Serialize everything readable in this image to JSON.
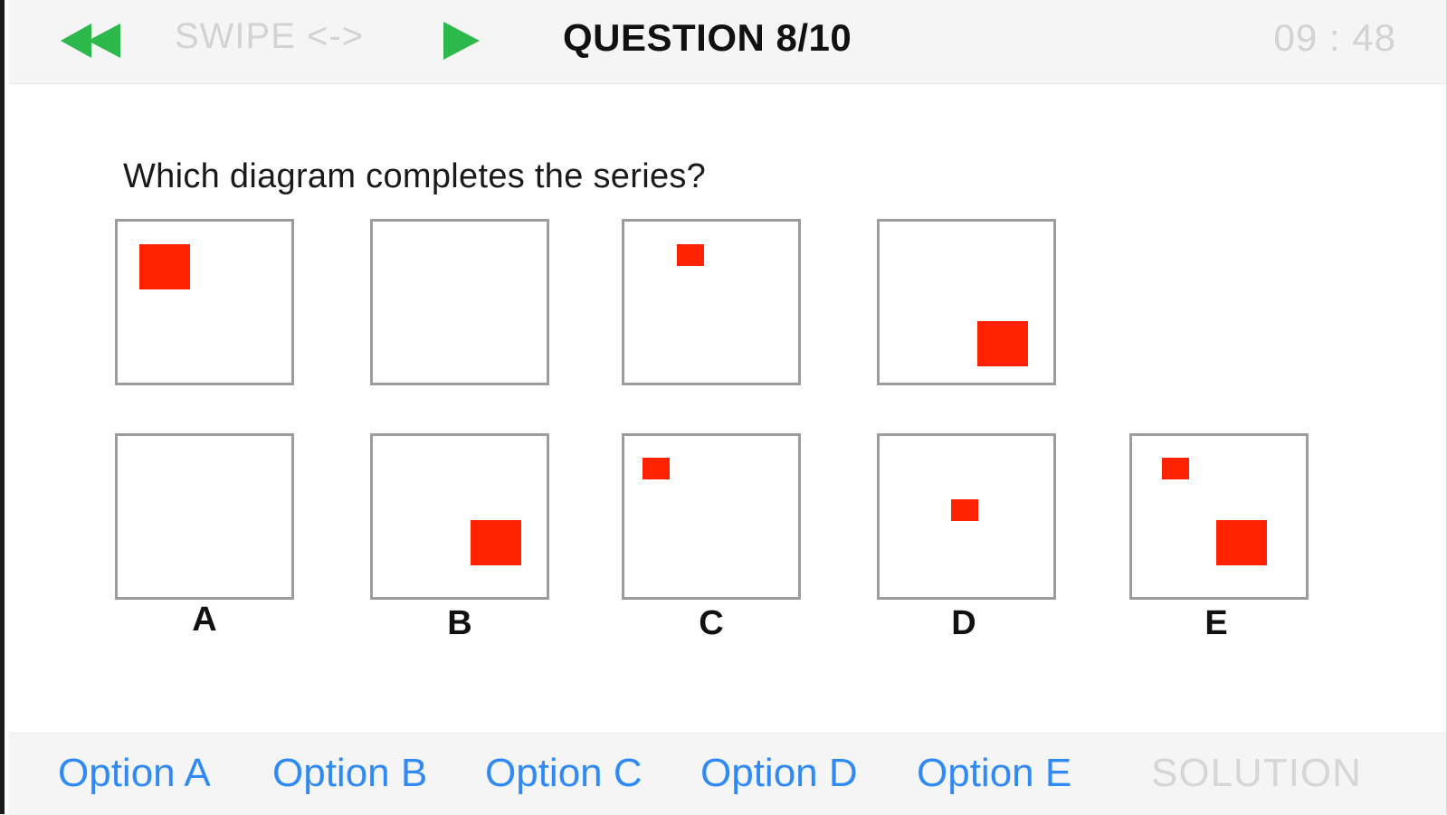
{
  "header": {
    "rewind_icon": "rewind-icon",
    "swipe_hint": "SWIPE <->",
    "play_icon": "play-icon",
    "question_counter": "QUESTION 8/10",
    "timer": "09 : 48",
    "accent_color": "#2db84b"
  },
  "question": {
    "prompt": "Which diagram completes the series?",
    "square_color": "#ff2200"
  },
  "answers": {
    "letters": [
      "A",
      "B",
      "C",
      "D",
      "E"
    ]
  },
  "footer": {
    "options": [
      "Option A",
      "Option B",
      "Option C",
      "Option D",
      "Option E"
    ],
    "solution": "SOLUTION",
    "link_color": "#2f8af5"
  }
}
